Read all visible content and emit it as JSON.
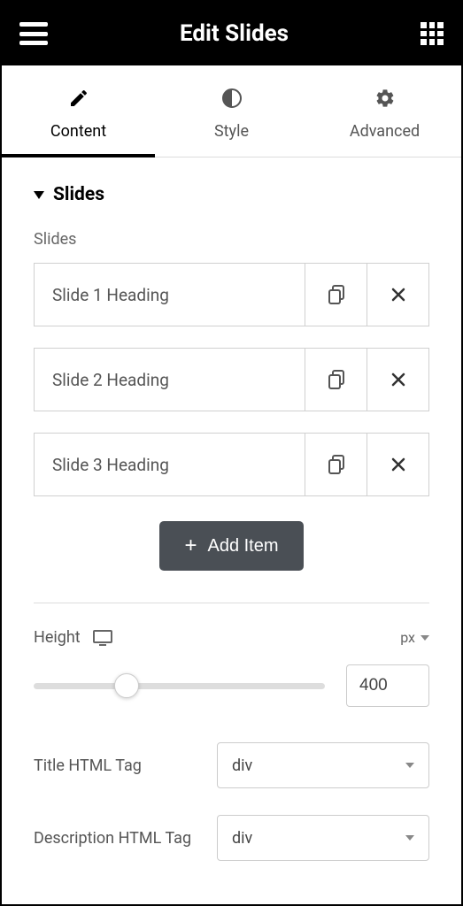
{
  "header": {
    "title": "Edit Slides"
  },
  "tabs": [
    {
      "label": "Content",
      "active": true
    },
    {
      "label": "Style",
      "active": false
    },
    {
      "label": "Advanced",
      "active": false
    }
  ],
  "section": {
    "title": "Slides",
    "items_label": "Slides",
    "items": [
      {
        "title": "Slide 1 Heading"
      },
      {
        "title": "Slide 2 Heading"
      },
      {
        "title": "Slide 3 Heading"
      }
    ],
    "add_label": "Add Item"
  },
  "height": {
    "label": "Height",
    "unit": "px",
    "value": "400"
  },
  "title_tag": {
    "label": "Title HTML Tag",
    "value": "div"
  },
  "description_tag": {
    "label": "Description HTML Tag",
    "value": "div"
  }
}
